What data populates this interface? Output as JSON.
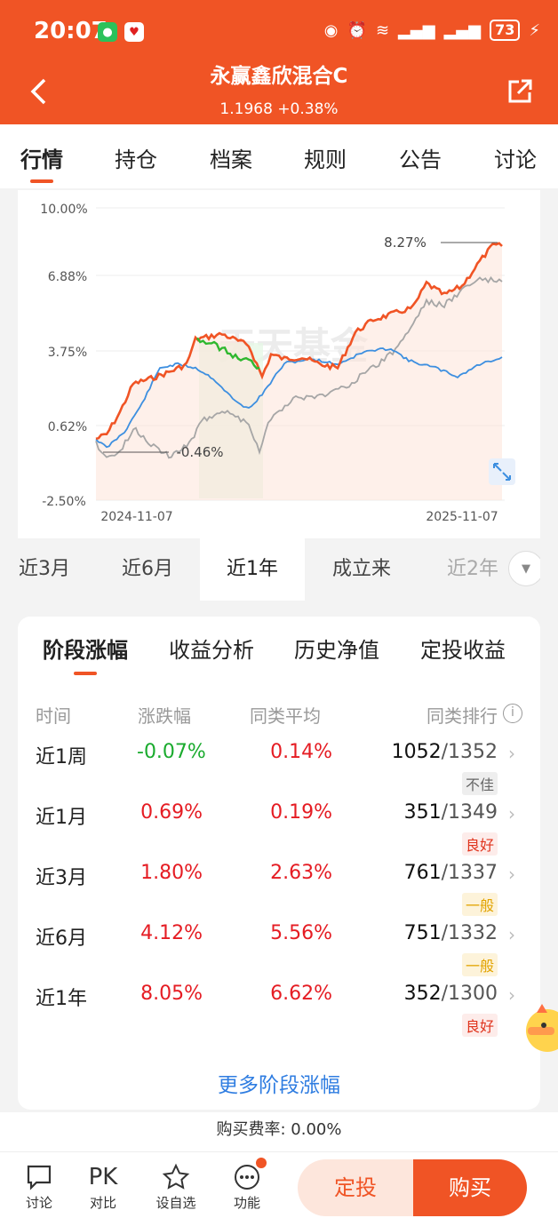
{
  "status": {
    "time": "20:07",
    "battery": "73"
  },
  "header": {
    "title": "永赢鑫欣混合C",
    "nav": "1.1968",
    "change": "+0.38%"
  },
  "tabs": [
    "行情",
    "持仓",
    "档案",
    "规则",
    "公告",
    "讨论"
  ],
  "chart": {
    "watermark": "天天基金",
    "high_label": "8.27%",
    "low_label": "-0.46%",
    "y_ticks": [
      "10.00%",
      "6.88%",
      "3.75%",
      "0.62%",
      "-2.50%"
    ],
    "x_start": "2024-11-07",
    "x_end": "2025-11-07",
    "colors": {
      "fund": "#f05425",
      "peer": "#3d8fe0",
      "index": "#a6a6a6",
      "down": "#2fb82f"
    }
  },
  "ranges": [
    "近3月",
    "近6月",
    "近1年",
    "成立来",
    "近2年"
  ],
  "perf": {
    "tabs": [
      "阶段涨幅",
      "收益分析",
      "历史净值",
      "定投收益"
    ],
    "headers": {
      "period": "时间",
      "change": "涨跌幅",
      "avg": "同类平均",
      "rank": "同类排行"
    },
    "rows": [
      {
        "period": "近1周",
        "change": "-0.07%",
        "avg": "0.14%",
        "rank": "1052",
        "total": "/1352",
        "tag": "不佳"
      },
      {
        "period": "近1月",
        "change": "0.69%",
        "avg": "0.19%",
        "rank": "351",
        "total": "/1349",
        "tag": "良好"
      },
      {
        "period": "近3月",
        "change": "1.80%",
        "avg": "2.63%",
        "rank": "761",
        "total": "/1337",
        "tag": "一般"
      },
      {
        "period": "近6月",
        "change": "4.12%",
        "avg": "5.56%",
        "rank": "751",
        "total": "/1332",
        "tag": "一般"
      },
      {
        "period": "近1年",
        "change": "8.05%",
        "avg": "6.62%",
        "rank": "352",
        "total": "/1300",
        "tag": "良好"
      }
    ],
    "more": "更多阶段涨幅"
  },
  "fee": "购买费率: 0.00%",
  "bottom": {
    "discuss": "讨论",
    "pk_glyph": "PK",
    "compare": "对比",
    "watch": "设自选",
    "func": "功能",
    "dingtou": "定投",
    "buy": "购买"
  }
}
